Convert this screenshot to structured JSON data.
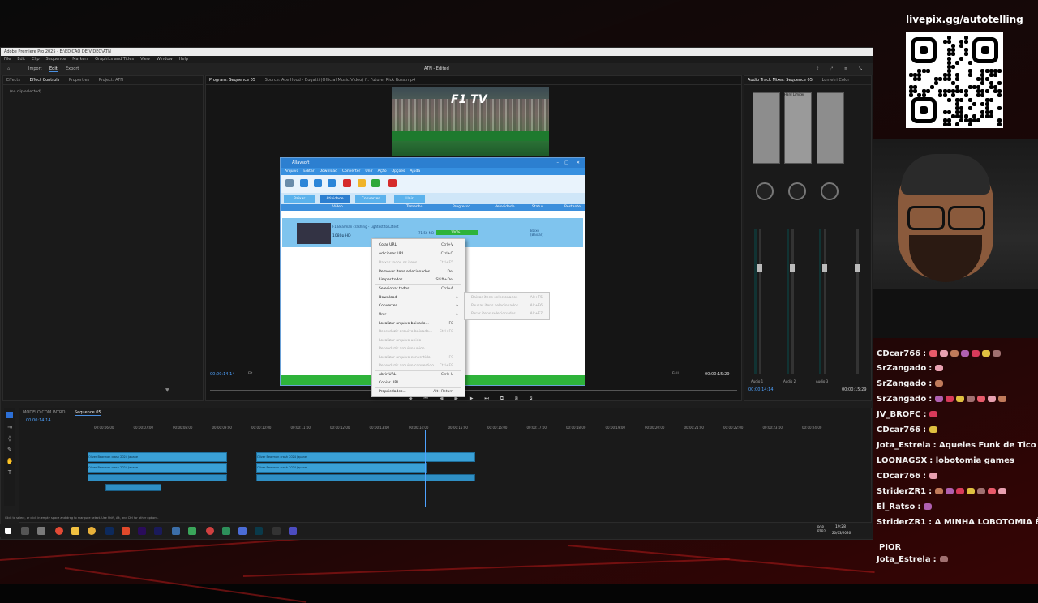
{
  "stream": {
    "livepix": "livepix.gg/autotelling"
  },
  "premiere": {
    "title": "Adobe Premiere Pro 2025 - E:\\EDIÇÃO DE VIDEO\\ATN",
    "menu": [
      "File",
      "Edit",
      "Clip",
      "Sequence",
      "Markers",
      "Graphics and Titles",
      "View",
      "Window",
      "Help"
    ],
    "workspaces": [
      "Import",
      "Edit",
      "Export"
    ],
    "project_name": "ATN - Edited",
    "left_tabs": [
      "Effects",
      "Effect Controls",
      "Properties",
      "Project: ATN"
    ],
    "no_clip": "(no clip selected)",
    "program_tab": "Program: Sequence 05",
    "source_tab": "Source: Ace Hood - Bugatti (Official Music Video) ft. Future, Rick Ross.mp4",
    "program_timecode": "00:00:14:14",
    "program_fit": "Fit",
    "program_full": "Full",
    "program_duration": "00:00:15:29",
    "mixer_tabs": [
      "Audio Track Mixer: Sequence 05",
      "Lumetri Color"
    ],
    "mixer_label": "Hard Limiter",
    "mixer_channels": [
      "Audio 1",
      "Audio 2",
      "Audio 3"
    ],
    "mixer_timecode": "00:00:15:29",
    "mixer_start": "00:00:14:14",
    "timeline_tabs": [
      "MODELO COM INTRO",
      "Sequence 05"
    ],
    "timeline_timecode": "00:00:14:14",
    "ruler": [
      "00:00:06:00",
      "00:00:07:00",
      "00:00:08:00",
      "00:00:09:00",
      "00:00:10:00",
      "00:00:11:00",
      "00:00:12:00",
      "00:00:13:00",
      "00:00:14:00",
      "00:00:15:00",
      "00:00:16:00",
      "00:00:17:00",
      "00:00:18:00",
      "00:00:19:00",
      "00:00:20:00",
      "00:00:21:00",
      "00:00:22:00",
      "00:00:23:00",
      "00:00:24:00"
    ],
    "clip_label": "Oliver Bearman crash 2024 Japane",
    "status_hint": "Click to select, or click in empty space and drag to marquee select. Use Shift, Alt, and Ctrl for other options."
  },
  "allavsoft": {
    "title": "Allavsoft",
    "menu": [
      "Arquivo",
      "Editar",
      "Download",
      "Converter",
      "Unir",
      "Ação",
      "Opções",
      "Ajuda"
    ],
    "tabs": [
      "Baixar",
      "Atividade",
      "Converter",
      "Unir"
    ],
    "columns": [
      "Vídeo",
      "Tamanho",
      "Progresso",
      "Velocidade",
      "Status",
      "Restante"
    ],
    "row_title": "F1 Bearman crashing - Lightest to Latest",
    "row_quality": "1080p HD",
    "row_size": "71.56 MB",
    "row_progress": "100%",
    "row_status": "Baixo (Baixar)"
  },
  "context_menu": {
    "items": [
      {
        "label": "Colar URL",
        "shortcut": "Ctrl+V",
        "enabled": true
      },
      {
        "label": "Adicionar URL",
        "shortcut": "Ctrl+O",
        "enabled": true
      },
      {
        "label": "Baixar todos os itens",
        "shortcut": "Ctrl+F5",
        "enabled": false
      },
      {
        "label": "Remover itens selecionados",
        "shortcut": "Del",
        "enabled": true
      },
      {
        "label": "Limpar todos",
        "shortcut": "Shift+Del",
        "enabled": true
      },
      {
        "label": "Selecionar todos",
        "shortcut": "Ctrl+A",
        "enabled": true
      },
      {
        "label": "Download",
        "shortcut": "",
        "enabled": true,
        "submenu": true
      },
      {
        "label": "Converter",
        "shortcut": "",
        "enabled": true,
        "submenu": true
      },
      {
        "label": "Unir",
        "shortcut": "",
        "enabled": true,
        "submenu": true
      },
      {
        "label": "Localizar arquivo baixado...",
        "shortcut": "F8",
        "enabled": true
      },
      {
        "label": "Reproduzir arquivo baixado...",
        "shortcut": "Ctrl+F8",
        "enabled": false
      },
      {
        "label": "Localizar arquivo unido",
        "shortcut": "",
        "enabled": false
      },
      {
        "label": "Reproduzir arquivo unido...",
        "shortcut": "",
        "enabled": false
      },
      {
        "label": "Localizar arquivo convertido",
        "shortcut": "F9",
        "enabled": false
      },
      {
        "label": "Reproduzir arquivo convertido...",
        "shortcut": "Ctrl+F9",
        "enabled": false
      },
      {
        "label": "Abrir URL",
        "shortcut": "Ctrl+U",
        "enabled": true
      },
      {
        "label": "Copiar URL",
        "shortcut": "",
        "enabled": true
      },
      {
        "label": "Propriedades...",
        "shortcut": "Alt+Return",
        "enabled": true
      }
    ],
    "submenu": [
      {
        "label": "Baixar itens selecionados",
        "shortcut": "Alt+F5"
      },
      {
        "label": "Pausar itens selecionados",
        "shortcut": "Alt+F6"
      },
      {
        "label": "Parar itens selecionados",
        "shortcut": "Alt+F7"
      }
    ]
  },
  "taskbar": {
    "lang": "POR PTB2",
    "time": "19:28",
    "date": "20/03/2026"
  },
  "chat": [
    {
      "user": "CDcar766",
      "text": ":",
      "color": "#f2f2f2"
    },
    {
      "user": "SrZangado",
      "text": ":",
      "color": "#f2f2f2"
    },
    {
      "user": "SrZangado",
      "text": ":",
      "color": "#f2f2f2"
    },
    {
      "user": "SrZangado",
      "text": ":",
      "color": "#f2f2f2"
    },
    {
      "user": "JV_BROFC",
      "text": ":",
      "color": "#f2f2f2"
    },
    {
      "user": "CDcar766",
      "text": ":",
      "color": "#f2f2f2"
    },
    {
      "user": "Jota_Estrela",
      "text": ": Aqueles Funk de Tico Teco",
      "color": "#f2f2f2"
    },
    {
      "user": "LOONAGSX",
      "text": ": lobotomia games",
      "color": "#f2f2f2"
    },
    {
      "user": "CDcar766",
      "text": ":",
      "color": "#f2f2f2"
    },
    {
      "user": "StriderZR1",
      "text": ":",
      "color": "#f2f2f2"
    },
    {
      "user": "El_Ratso",
      "text": ":",
      "color": "#f2f2f2"
    },
    {
      "user": "StriderZR1",
      "text": ": A MINHA LOBOTOMIA É",
      "color": "#f2f2f2"
    },
    {
      "user": "",
      "text": "PIOR",
      "color": "#f2f2f2"
    },
    {
      "user": "Jota_Estrela",
      "text": ":",
      "color": "#f2f2f2"
    }
  ]
}
